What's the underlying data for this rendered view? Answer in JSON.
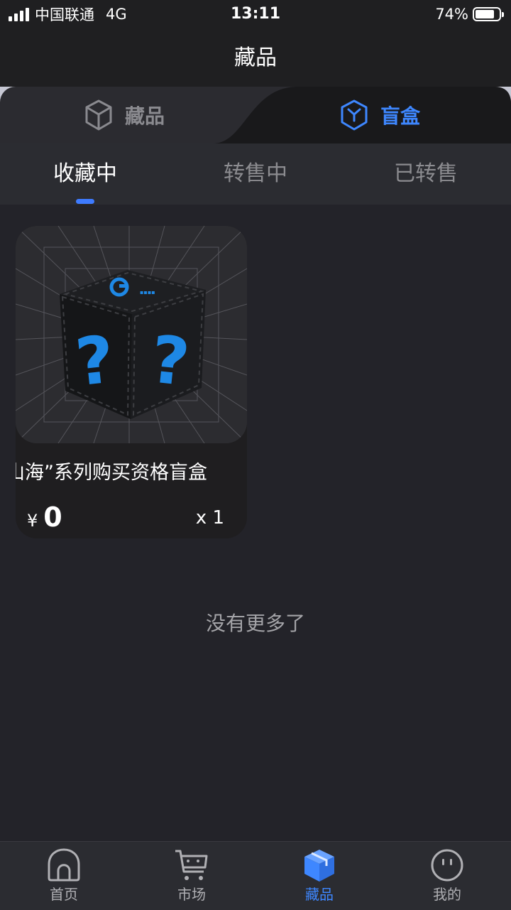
{
  "status_bar": {
    "carrier": "中国联通",
    "network": "4G",
    "time": "13:11",
    "battery": "74%"
  },
  "nav": {
    "title": "藏品"
  },
  "top_tabs": [
    {
      "label": "藏品",
      "icon": "cube-outline-icon",
      "active": false
    },
    {
      "label": "盲盒",
      "icon": "blind-box-icon",
      "active": true
    }
  ],
  "sub_tabs": [
    {
      "label": "收藏中",
      "active": true
    },
    {
      "label": "转售中",
      "active": false
    },
    {
      "label": "已转售",
      "active": false
    }
  ],
  "items": [
    {
      "name": "山海”系列购买资格盲盒",
      "currency": "¥",
      "price": "0",
      "quantity": "x 1",
      "image": "mystery-box-image"
    }
  ],
  "list_footer": "没有更多了",
  "bottom_nav": [
    {
      "label": "首页",
      "icon": "home-icon",
      "active": false
    },
    {
      "label": "市场",
      "icon": "cart-icon",
      "active": false
    },
    {
      "label": "藏品",
      "icon": "collection-box-icon",
      "active": true
    },
    {
      "label": "我的",
      "icon": "profile-face-icon",
      "active": false
    }
  ],
  "colors": {
    "accent": "#3e87ff",
    "background": "#232329",
    "card": "#1f1e20"
  }
}
